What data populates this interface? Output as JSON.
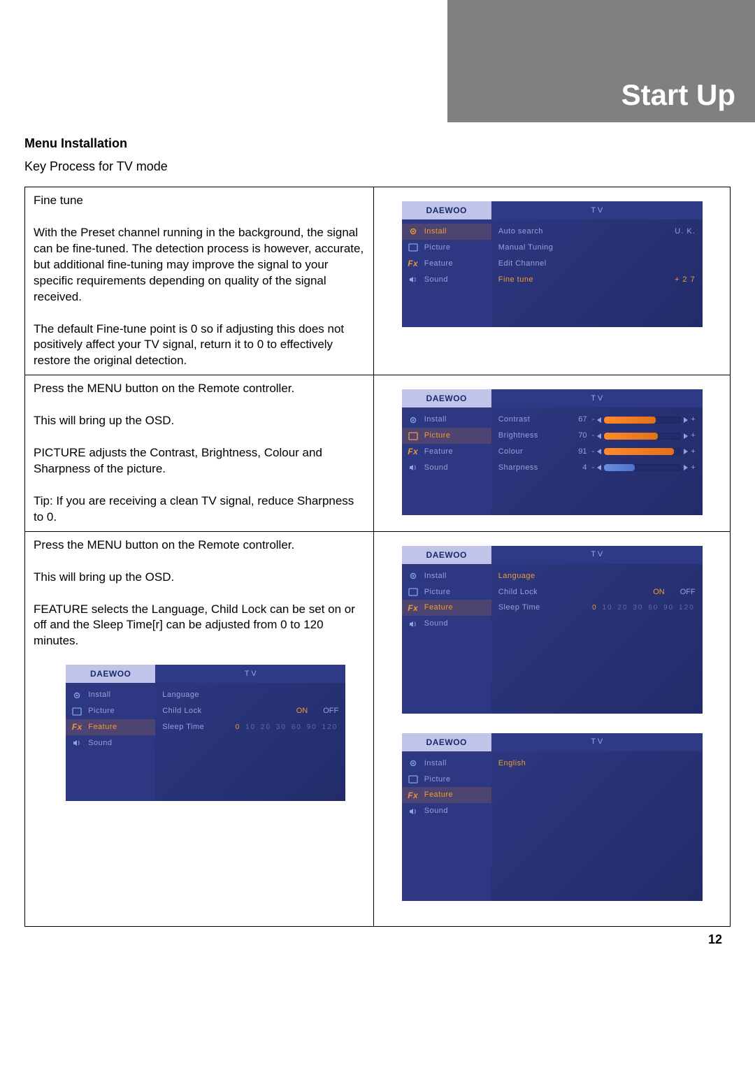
{
  "header": {
    "title": "Start Up"
  },
  "heading": "Menu Installation",
  "subheading": "Key Process for TV mode",
  "page_number": "12",
  "brand": "DAEWOO",
  "tv_label": "T   V",
  "nav": {
    "install": "Install",
    "picture": "Picture",
    "feature": "Feature",
    "sound": "Sound",
    "fx": "Fx"
  },
  "row1": {
    "title": "Fine tune",
    "p1": "With the Preset channel running in the background, the signal can be fine-tuned. The detection process is however, accurate, but additional fine-tuning may improve the signal to your specific requirements depending on quality of the signal received.",
    "p2": "The default Fine-tune point is 0 so if adjusting this does not positively affect your TV signal, return it to 0 to effectively restore the original detection.",
    "osd": {
      "auto_search": "Auto search",
      "auto_search_val": "U. K.",
      "manual_tuning": "Manual Tuning",
      "edit_channel": "Edit Channel",
      "fine_tune": "Fine tune",
      "fine_tune_val": "+ 2 7"
    }
  },
  "row2": {
    "p1": "Press the MENU button on the Remote controller.",
    "p2": "This will bring up the OSD.",
    "p3": "PICTURE adjusts the Contrast, Brightness, Colour and Sharpness of the picture.",
    "p4": "Tip: If you are receiving a clean TV signal, reduce Sharpness to 0.",
    "osd": {
      "contrast": "Contrast",
      "contrast_val": "67",
      "brightness": "Brightness",
      "brightness_val": "70",
      "colour": "Colour",
      "colour_val": "91",
      "sharpness": "Sharpness",
      "sharpness_val": "4"
    }
  },
  "row3": {
    "p1": "Press the MENU button on the Remote controller.",
    "p2": "This will bring up the OSD.",
    "p3": "FEATURE selects the Language, Child Lock can be set on or off and the Sleep Time[r] can be adjusted from 0 to 120 minutes.",
    "osd_feature": {
      "language": "Language",
      "child_lock": "Child Lock",
      "on": "ON",
      "off": "OFF",
      "sleep_time": "Sleep Time",
      "sleep_vals": [
        "0",
        "10",
        "20",
        "30",
        "60",
        "90",
        "120"
      ]
    },
    "osd_lang": {
      "english": "English"
    }
  }
}
